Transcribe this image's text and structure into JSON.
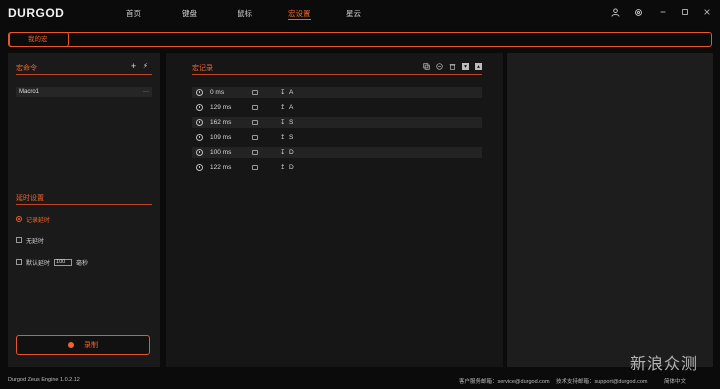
{
  "app": {
    "logo": "DURGOD"
  },
  "nav": {
    "items": [
      {
        "label": "首页"
      },
      {
        "label": "键盘"
      },
      {
        "label": "鼠标"
      },
      {
        "label": "宏设置"
      },
      {
        "label": "星云"
      }
    ],
    "active_index": 3
  },
  "window": {
    "user_icon": "user-icon",
    "settings_icon": "gear-icon",
    "minimize_icon": "minimize-icon",
    "maximize_icon": "maximize-icon",
    "close_icon": "close-icon"
  },
  "subtab": {
    "label": "我的宏"
  },
  "macro_commands": {
    "title": "宏命令",
    "add_icon": "plus-icon",
    "import_icon": "lightning-icon",
    "items": [
      {
        "name": "Macro1",
        "more": "···"
      }
    ]
  },
  "delay_settings": {
    "title": "延时设置",
    "options": [
      {
        "label": "记录延时",
        "selected": true
      },
      {
        "label": "无延时",
        "selected": false
      },
      {
        "label": "默认延时",
        "selected": false
      }
    ],
    "default_delay_value": "100",
    "default_delay_unit": "毫秒"
  },
  "record_button": {
    "label": "录制"
  },
  "macro_record": {
    "title": "宏记录",
    "toolbar_icons": [
      "copy-icon",
      "delete-icon",
      "trash-icon",
      "move-down-icon",
      "move-up-icon"
    ],
    "rows": [
      {
        "time": "0 ms",
        "direction": "↧",
        "key": "A"
      },
      {
        "time": "129 ms",
        "direction": "↥",
        "key": "A"
      },
      {
        "time": "162 ms",
        "direction": "↧",
        "key": "S"
      },
      {
        "time": "109 ms",
        "direction": "↥",
        "key": "S"
      },
      {
        "time": "100 ms",
        "direction": "↧",
        "key": "D"
      },
      {
        "time": "122 ms",
        "direction": "↥",
        "key": "D"
      }
    ]
  },
  "footer": {
    "version": "Durgod Zeus Engine 1.0.2.12",
    "service": "客户服务邮箱：service@durgod.com",
    "support": "技术支持邮箱：support@durgod.com",
    "language": "简体中文"
  },
  "watermark": "新浪众测",
  "colors": {
    "accent": "#f0642a",
    "background": "#0b0b0b",
    "panel": "#1a1a1a"
  }
}
